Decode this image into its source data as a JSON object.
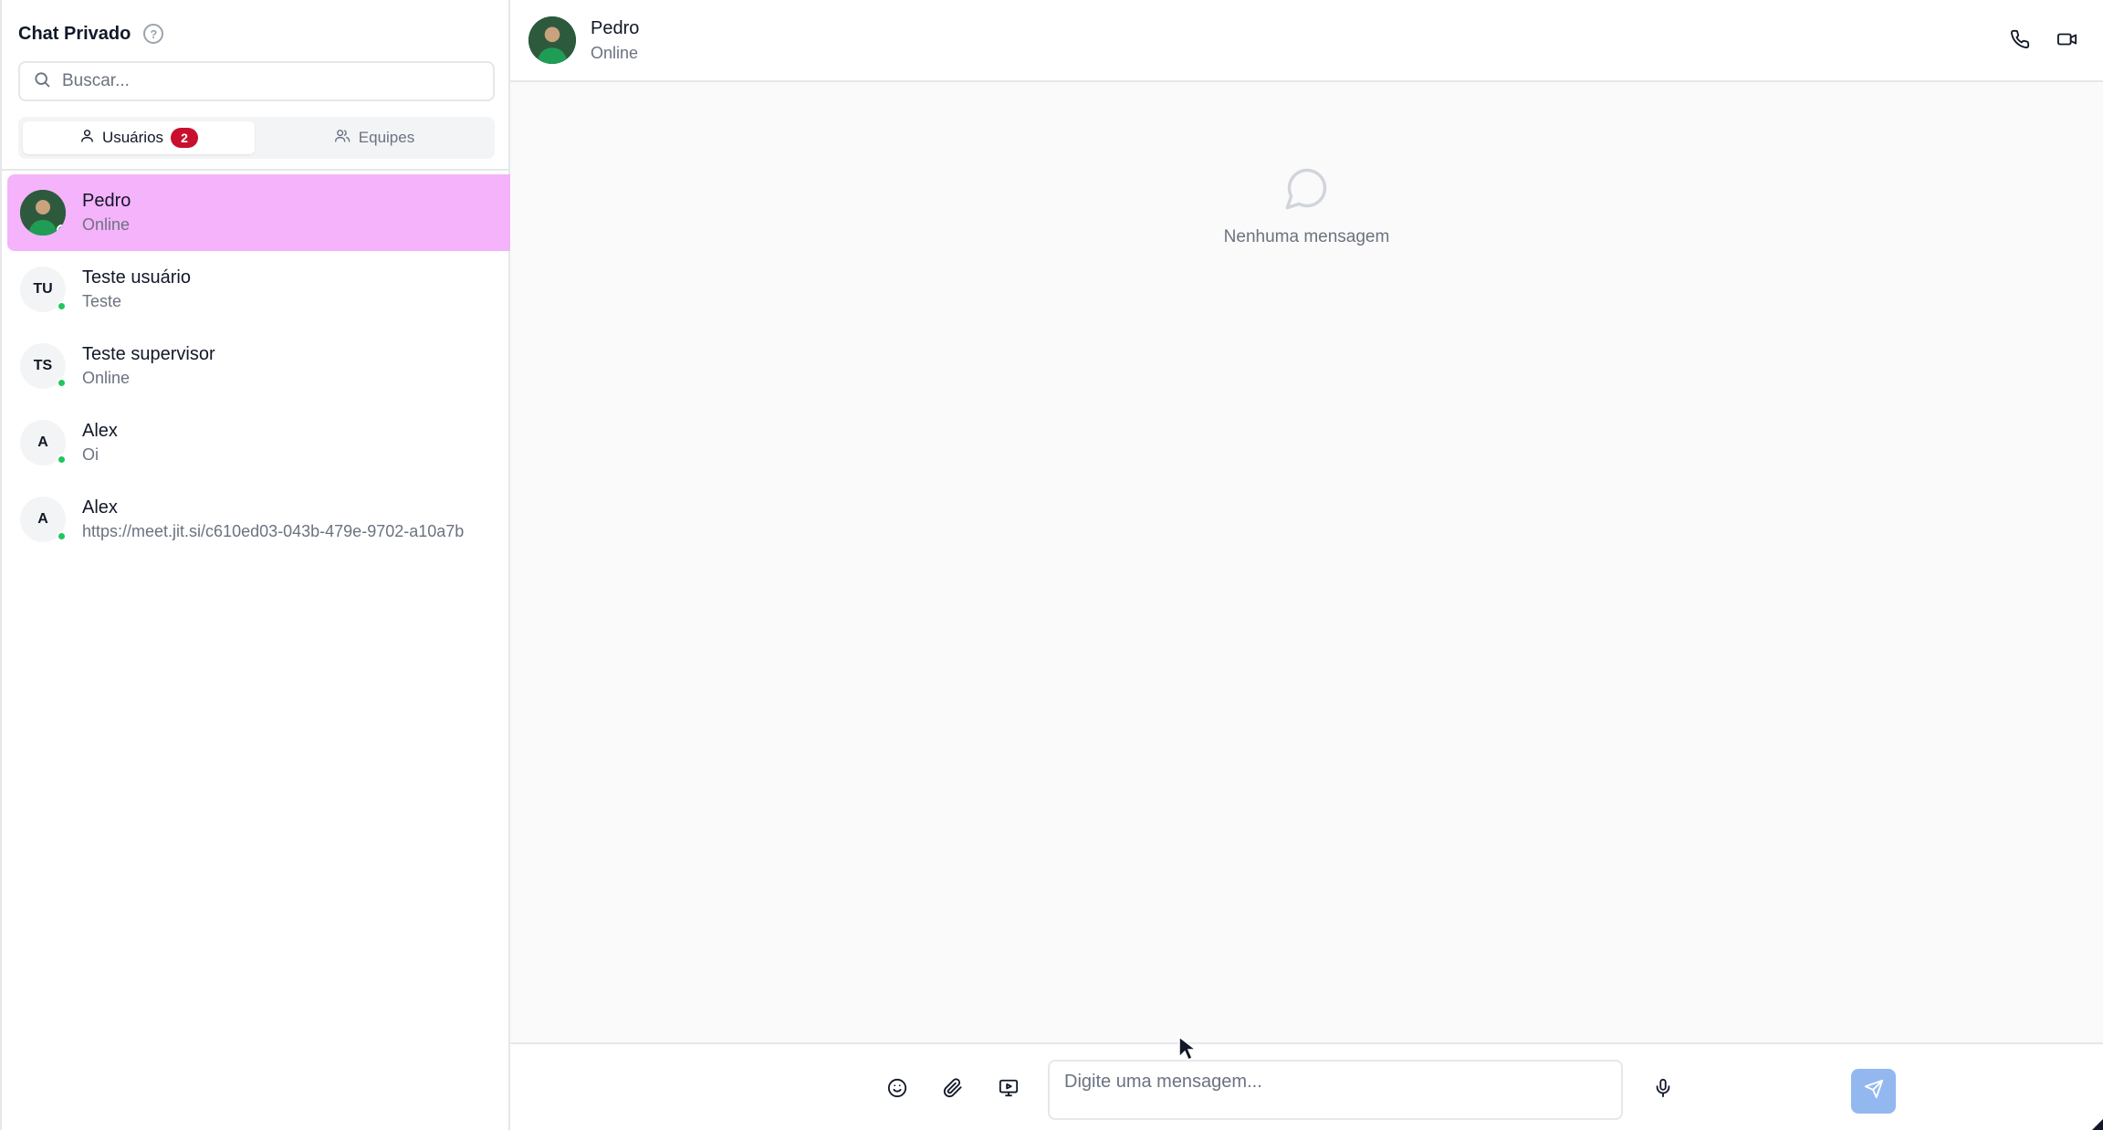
{
  "sidebar": {
    "title": "Chat Privado",
    "help_icon": "help-circle-icon",
    "search": {
      "placeholder": "Buscar...",
      "value": ""
    },
    "tabs": [
      {
        "label": "Usuários",
        "badge": "2",
        "icon": "user-icon",
        "active": true
      },
      {
        "label": "Equipes",
        "icon": "users-icon",
        "active": false
      }
    ],
    "conversations": [
      {
        "name": "Pedro",
        "preview": "Online",
        "initials": "",
        "has_photo": true,
        "online": true,
        "active": true
      },
      {
        "name": "Teste usuário",
        "preview": "Teste",
        "initials": "TU",
        "online": true
      },
      {
        "name": "Teste supervisor",
        "preview": "Online",
        "initials": "TS",
        "online": true
      },
      {
        "name": "Alex",
        "preview": "Oi",
        "initials": "A",
        "online": true
      },
      {
        "name": "Alex",
        "preview": "https://meet.jit.si/c610ed03-043b-479e-9702-a10a7b",
        "initials": "A",
        "online": true
      }
    ]
  },
  "chat": {
    "name": "Pedro",
    "status": "Online",
    "actions": [
      "phone-icon",
      "video-icon"
    ],
    "empty_text": "Nenhuma mensagem",
    "composer": {
      "placeholder": "Digite uma mensagem...",
      "value": "",
      "tools": [
        "emoji-icon",
        "paperclip-icon",
        "screen-share-icon",
        "mic-icon",
        "send-icon"
      ]
    }
  },
  "colors": {
    "active_conversation": "#f4b3fb",
    "badge": "#c8102e",
    "online": "#22c55e",
    "send_button": "#93b8f0"
  }
}
